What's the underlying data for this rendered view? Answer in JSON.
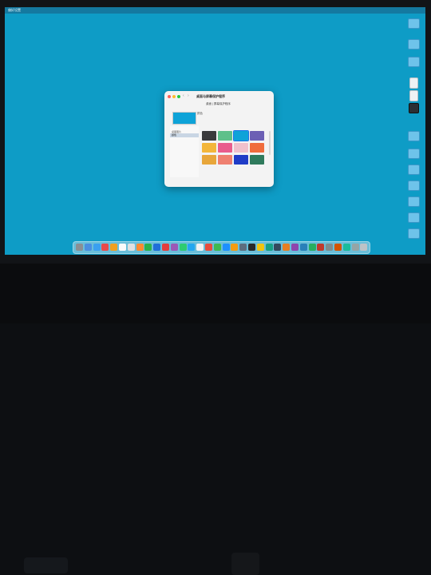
{
  "menubar": {
    "app_name": "偏好设置",
    "status_text": ""
  },
  "desktop_icons": [
    {
      "label": "",
      "type": "folder"
    },
    {
      "label": "",
      "type": "folder"
    },
    {
      "label": "",
      "type": "folder"
    },
    {
      "label": "",
      "type": "doc"
    },
    {
      "label": "",
      "type": "doc"
    },
    {
      "label": "",
      "type": "app"
    },
    {
      "label": "",
      "type": "folder"
    },
    {
      "label": "",
      "type": "folder"
    },
    {
      "label": "",
      "type": "folder"
    },
    {
      "label": "",
      "type": "folder"
    },
    {
      "label": "",
      "type": "folder"
    },
    {
      "label": "",
      "type": "folder"
    },
    {
      "label": "",
      "type": "folder"
    }
  ],
  "window": {
    "title": "桌面与屏幕保护程序",
    "dropdown": "桌面 | 屏幕保护程序",
    "preview_label": "颜色",
    "preview_color": "#0ea3d8",
    "sidebar_items": [
      {
        "label": "",
        "selected": false
      },
      {
        "label": "桌面图片",
        "selected": false
      },
      {
        "label": "颜色",
        "selected": true
      },
      {
        "label": "",
        "selected": false
      },
      {
        "label": "",
        "selected": false
      },
      {
        "label": "",
        "selected": false
      },
      {
        "label": "",
        "selected": false
      },
      {
        "label": "",
        "selected": false
      },
      {
        "label": "",
        "selected": false
      },
      {
        "label": "",
        "selected": false
      },
      {
        "label": "",
        "selected": false
      },
      {
        "label": "",
        "selected": false
      },
      {
        "label": "",
        "selected": false
      },
      {
        "label": "",
        "selected": false
      }
    ],
    "swatches": [
      {
        "name": "black",
        "color": "#3a3a3c",
        "selected": false
      },
      {
        "name": "green",
        "color": "#5ec08a",
        "selected": false
      },
      {
        "name": "blue",
        "color": "#0ea3d8",
        "selected": true
      },
      {
        "name": "purple",
        "color": "#6c5fb4",
        "selected": false
      },
      {
        "name": "yellow",
        "color": "#f3b63a",
        "selected": false
      },
      {
        "name": "pink",
        "color": "#e95c8d",
        "selected": false
      },
      {
        "name": "light-pink",
        "color": "#f0c0cc",
        "selected": false
      },
      {
        "name": "orange",
        "color": "#f06c3c",
        "selected": false
      },
      {
        "name": "gold",
        "color": "#e8a63a",
        "selected": false
      },
      {
        "name": "salmon",
        "color": "#ef8070",
        "selected": false
      },
      {
        "name": "navy",
        "color": "#1f3cc7",
        "selected": false
      },
      {
        "name": "teal",
        "color": "#2f7a5c",
        "selected": false
      }
    ],
    "bottom_label": "",
    "custom_color_link": ""
  },
  "dock_colors": [
    "#8a8f94",
    "#4a8fe0",
    "#3aa0f0",
    "#e84a4a",
    "#f0a020",
    "#fafafa",
    "#e0e0e0",
    "#ff8a30",
    "#2bb24c",
    "#1f6fd8",
    "#e43c3c",
    "#9b59b6",
    "#2ecc71",
    "#22a7f0",
    "#f2f2f2",
    "#e74c3c",
    "#3fb950",
    "#1e90ff",
    "#f39c12",
    "#5d6d7e",
    "#2a2a2a",
    "#f1c40f",
    "#16a085",
    "#34495e",
    "#e67e22",
    "#8e44ad",
    "#2980b9",
    "#27ae60",
    "#c0392b",
    "#7f8c8d",
    "#d35400",
    "#1abc9c",
    "#95a5a6",
    "#bdc3c7"
  ]
}
